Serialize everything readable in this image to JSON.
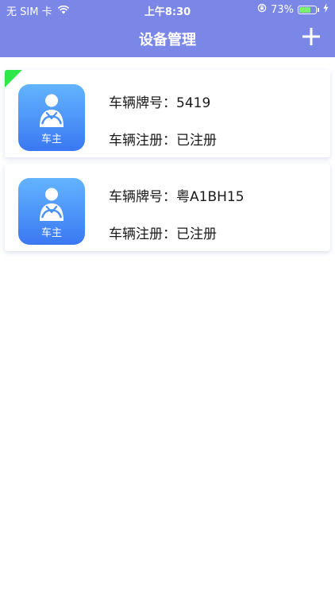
{
  "status_bar": {
    "carrier": "无 SIM 卡",
    "time": "上午8:30",
    "battery_percent": "73%",
    "battery_level": 0.73
  },
  "header": {
    "title": "设备管理",
    "add_icon": "plus-icon"
  },
  "vehicles": [
    {
      "role_label": "车主",
      "plate_label": "车辆牌号：",
      "plate": "5419",
      "registration_label": "车辆注册：",
      "registration": "已注册",
      "selected": true
    },
    {
      "role_label": "车主",
      "plate_label": "车辆牌号：",
      "plate": "粤A1BH15",
      "registration_label": "车辆注册：",
      "registration": "已注册",
      "selected": false
    }
  ],
  "colors": {
    "header_bg": "#7b87e6",
    "avatar_top": "#63b4ff",
    "avatar_bottom": "#3a78f2",
    "selected_tag": "#2ee84a",
    "battery_fill": "#7cf06e"
  }
}
